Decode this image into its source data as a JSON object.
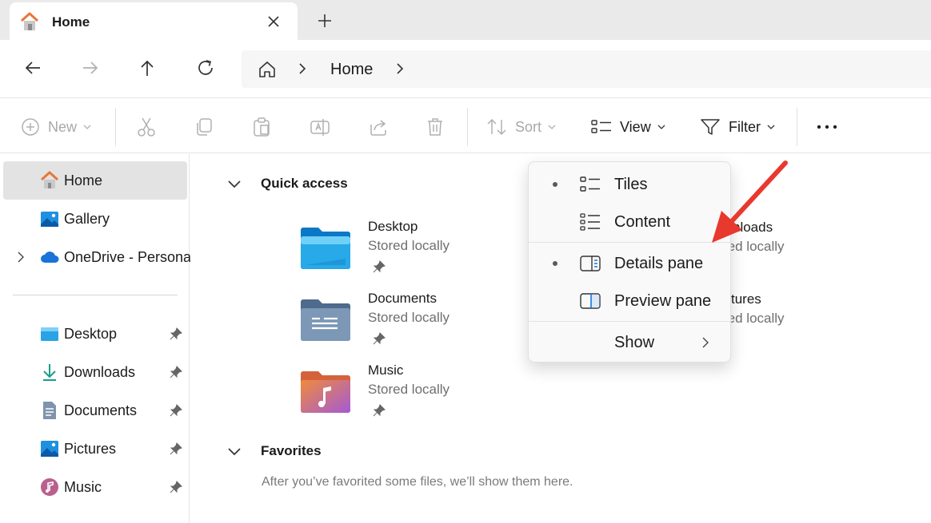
{
  "colors": {
    "accent": "#0067c0",
    "annotation_arrow": "#e8392f",
    "folder_blue": "#1f9fe0",
    "folder_gray": "#6b8aa8"
  },
  "tab": {
    "title": "Home",
    "icon": "home-icon",
    "close_icon": "close-icon",
    "new_tab_icon": "plus-icon"
  },
  "nav": {
    "back": "arrow-left-icon",
    "forward": "arrow-right-icon",
    "up": "arrow-up-icon",
    "refresh": "refresh-icon"
  },
  "address": {
    "home_icon": "home-outline-icon",
    "current": "Home"
  },
  "commandbar": {
    "new_label": "New",
    "sort_label": "Sort",
    "view_label": "View",
    "filter_label": "Filter",
    "more_icon": "more-icon"
  },
  "sidebar": {
    "items": [
      {
        "label": "Home",
        "icon": "home-icon",
        "selected": true
      },
      {
        "label": "Gallery",
        "icon": "gallery-icon"
      },
      {
        "label": "OneDrive - Persona",
        "icon": "cloud-icon"
      },
      {
        "label": "Desktop",
        "icon": "desktop-folder-icon",
        "pinned": true
      },
      {
        "label": "Downloads",
        "icon": "download-icon",
        "pinned": true
      },
      {
        "label": "Documents",
        "icon": "document-icon",
        "pinned": true
      },
      {
        "label": "Pictures",
        "icon": "pictures-icon",
        "pinned": true
      },
      {
        "label": "Music",
        "icon": "music-icon",
        "pinned": true
      }
    ]
  },
  "main": {
    "quick_access_title": "Quick access",
    "quick_access": [
      {
        "name": "Desktop",
        "status": "Stored locally"
      },
      {
        "name": "Documents",
        "status": "Stored locally"
      },
      {
        "name": "Music",
        "status": "Stored locally"
      }
    ],
    "partial_right": [
      {
        "name": "nloads",
        "status": "red locally"
      },
      {
        "name": "tures",
        "status": "red locally"
      }
    ],
    "favorites_title": "Favorites",
    "favorites_empty": "After you’ve favorited some files, we’ll show them here."
  },
  "view_menu": {
    "items": [
      {
        "label": "Tiles",
        "checked": true
      },
      {
        "label": "Content",
        "checked": false
      },
      {
        "label": "Details pane",
        "checked": true
      },
      {
        "label": "Preview pane",
        "checked": false
      },
      {
        "label": "Show",
        "submenu": true
      }
    ]
  }
}
